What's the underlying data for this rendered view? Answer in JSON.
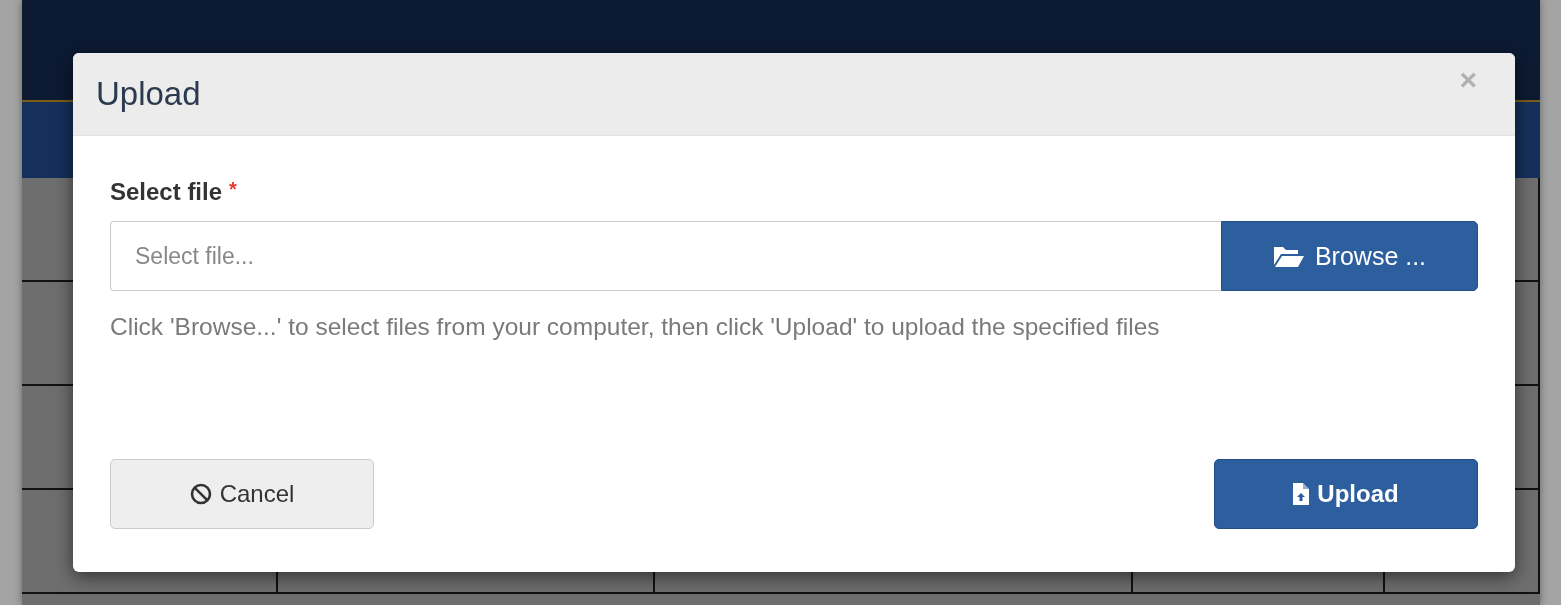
{
  "dialog": {
    "title": "Upload",
    "close": "×",
    "field": {
      "label": "Select file",
      "required_mark": "*",
      "placeholder": "Select file...",
      "browse": "Browse ..."
    },
    "help_text": "Click 'Browse...' to select files from your computer, then click 'Upload' to upload the specified files",
    "buttons": [
      {
        "kind": "cancel",
        "label": "Cancel"
      },
      {
        "kind": "upload",
        "label": "Upload"
      }
    ]
  }
}
